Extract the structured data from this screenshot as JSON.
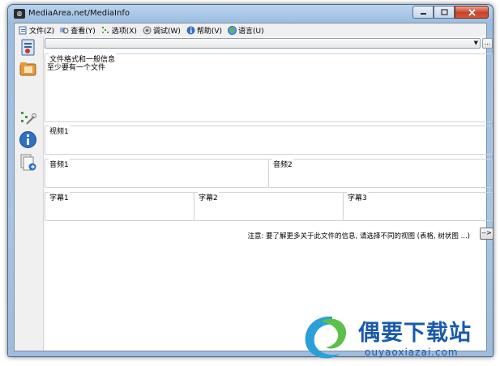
{
  "window": {
    "title": "MediaArea.net/MediaInfo"
  },
  "menubar": {
    "items": [
      {
        "label": "文件(Z)",
        "icon": "file-icon"
      },
      {
        "label": "查看(Y)",
        "icon": "view-icon"
      },
      {
        "label": "选项(X)",
        "icon": "options-icon"
      },
      {
        "label": "调试(W)",
        "icon": "debug-icon"
      },
      {
        "label": "帮助(V)",
        "icon": "help-icon"
      },
      {
        "label": "语言(U)",
        "icon": "language-icon"
      }
    ]
  },
  "toolbar": {
    "buttons": [
      "open-file-icon",
      "open-folder-icon",
      "preferences-icon",
      "about-icon",
      "export-icon"
    ]
  },
  "file_select": {
    "value": "",
    "browse_label": "..."
  },
  "sections": {
    "general": {
      "label": "文件格式和一般信息",
      "content": "至少要有一个文件"
    },
    "video1": {
      "label": "视频1"
    },
    "audio1": {
      "label": "音频1"
    },
    "audio2": {
      "label": "音频2"
    },
    "subtitle1": {
      "label": "字幕1"
    },
    "subtitle2": {
      "label": "字幕2"
    },
    "subtitle3": {
      "label": "字幕3"
    }
  },
  "note": {
    "text": "注意: 要了解更多关于此文件的信息, 请选择不同的视图 (表格, 树状图 ...)",
    "button_label": "-->"
  },
  "watermark": {
    "brand": "偶要下载站",
    "url": "ouyaoxiazai.com"
  },
  "colors": {
    "titlebar": "#b9d4ee",
    "close_button": "#c7432b",
    "border": "#d2d2d2",
    "brand": "#1a5aa8"
  }
}
